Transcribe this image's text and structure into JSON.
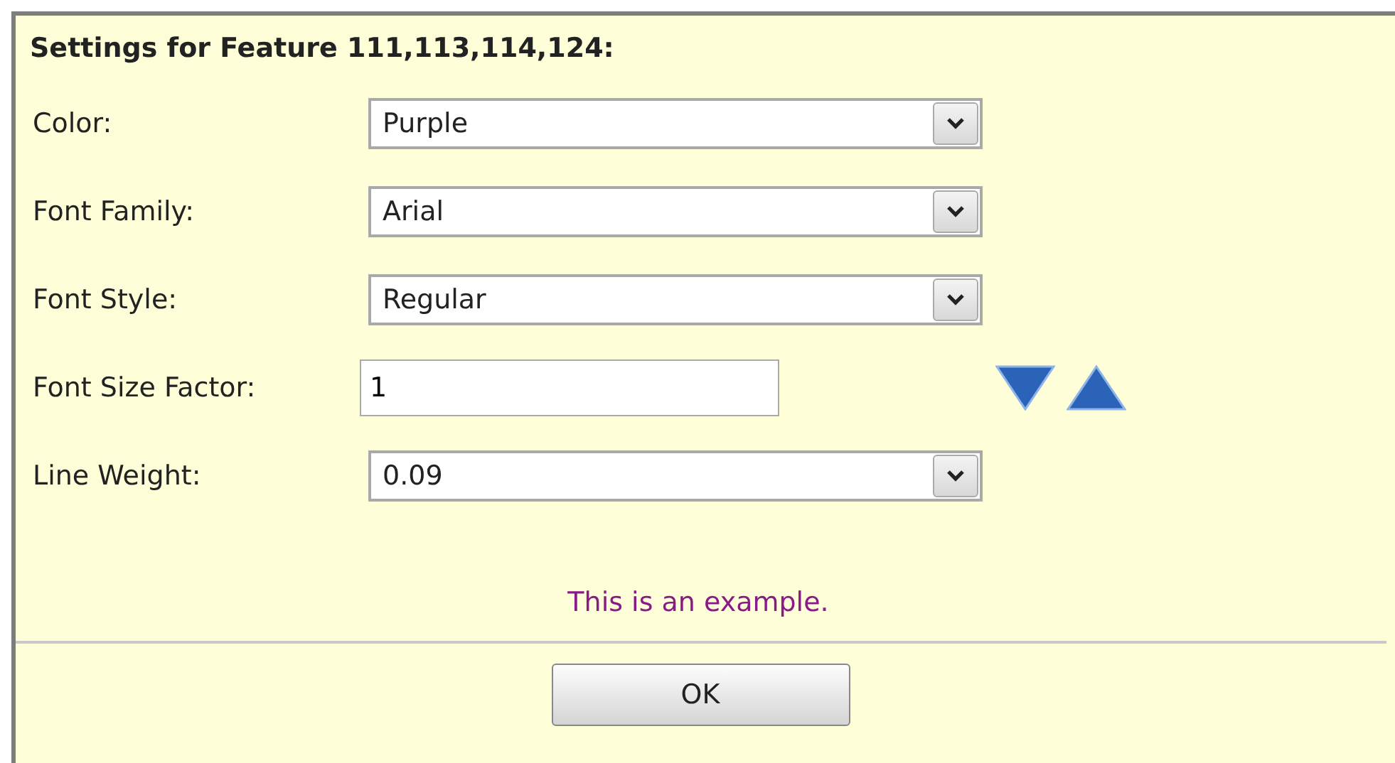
{
  "dialog": {
    "title": "Settings for Feature 111,113,114,124:"
  },
  "fields": [
    {
      "kind": "select",
      "label": "Color:",
      "value": "Purple"
    },
    {
      "kind": "select",
      "label": "Font Family:",
      "value": "Arial"
    },
    {
      "kind": "select",
      "label": "Font Style:",
      "value": "Regular"
    },
    {
      "kind": "text",
      "label": "Font Size Factor:",
      "value": "1"
    },
    {
      "kind": "select",
      "label": "Line Weight:",
      "value": "0.09"
    }
  ],
  "example": "This is an example.",
  "buttons": [
    "OK"
  ]
}
